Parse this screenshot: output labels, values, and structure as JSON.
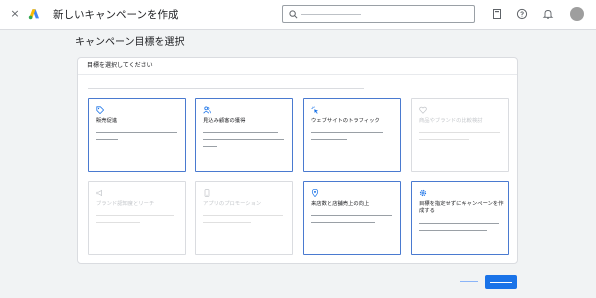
{
  "app": {
    "close_label": "×",
    "title": "新しいキャンペーンを作成"
  },
  "page": {
    "heading": "キャンペーン目標を選択"
  },
  "panel": {
    "header": "目標を選択してください",
    "cards": [
      {
        "label": "販売促進",
        "icon": "tag-icon",
        "state": "selectable"
      },
      {
        "label": "見込み顧客の獲得",
        "icon": "people-icon",
        "state": "selectable"
      },
      {
        "label": "ウェブサイトのトラフィック",
        "icon": "cursor-click-icon",
        "state": "selectable"
      },
      {
        "label": "商品やブランドの比較検討",
        "icon": "heart-icon",
        "state": "disabled"
      },
      {
        "label": "ブランド認知度とリーチ",
        "icon": "megaphone-icon",
        "state": "disabled"
      },
      {
        "label": "アプリのプロモーション",
        "icon": "phone-icon",
        "state": "disabled"
      },
      {
        "label": "来店数と店舗売上の向上",
        "icon": "location-pin-icon",
        "state": "selectable"
      },
      {
        "label": "目標を指定せずにキャンペーンを作成する",
        "icon": "gear-icon",
        "state": "selectable"
      }
    ]
  },
  "colors": {
    "accent": "#1a73e8",
    "card_border_active": "#4a7ad0",
    "disabled_text": "#c4c7cb"
  }
}
